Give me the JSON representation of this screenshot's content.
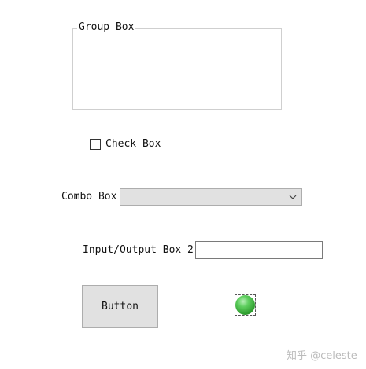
{
  "group_box": {
    "title": "Group Box"
  },
  "check_box": {
    "label": "Check Box",
    "checked": false
  },
  "combo_box": {
    "label": "Combo Box",
    "selected_value": "",
    "icon": "chevron-down-icon"
  },
  "io_box": {
    "label": "Input/Output Box 2",
    "value": ""
  },
  "button": {
    "label": "Button"
  },
  "led": {
    "state": "on",
    "color": "#3cb43c",
    "icon": "status-led-icon"
  },
  "watermark": {
    "text": "知乎 @celeste"
  },
  "colors": {
    "background": "#ffffff",
    "control_face": "#e1e1e1",
    "control_border": "#adadad",
    "group_border": "#cfcfcf"
  }
}
